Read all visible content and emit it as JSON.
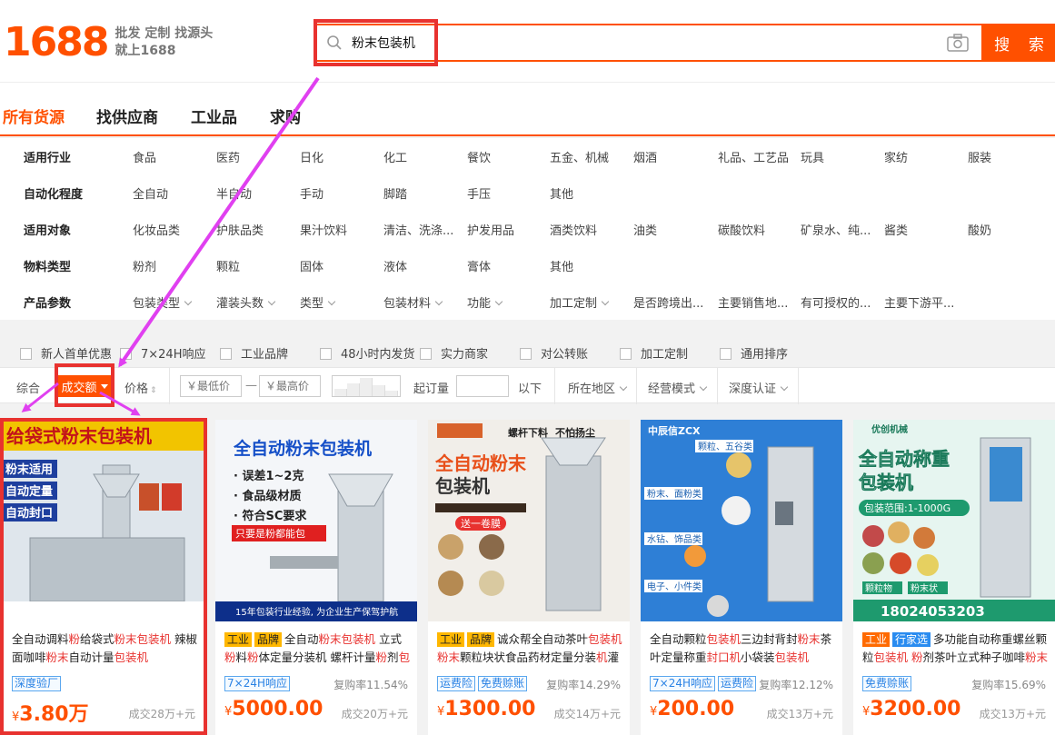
{
  "header": {
    "logo": "1688",
    "slogan_line1": "批发 定制 找源头",
    "slogan_line2": "就上1688",
    "search_value": "粉末包装机",
    "search_button": "搜 索"
  },
  "tabs": [
    "所有货源",
    "找供应商",
    "工业品",
    "求购"
  ],
  "filters": [
    {
      "label": "适用行业",
      "options": [
        "食品",
        "医药",
        "日化",
        "化工",
        "餐饮",
        "五金、机械",
        "烟酒",
        "礼品、工艺品",
        "玩具",
        "家纺",
        "服装"
      ]
    },
    {
      "label": "自动化程度",
      "options": [
        "全自动",
        "半自动",
        "手动",
        "脚踏",
        "手压",
        "其他"
      ]
    },
    {
      "label": "适用对象",
      "options": [
        "化妆品类",
        "护肤品类",
        "果汁饮料",
        "清洁、洗涤...",
        "护发用品",
        "酒类饮料",
        "油类",
        "碳酸饮料",
        "矿泉水、纯...",
        "酱类",
        "酸奶"
      ]
    },
    {
      "label": "物料类型",
      "options": [
        "粉剂",
        "颗粒",
        "固体",
        "液体",
        "膏体",
        "其他"
      ]
    },
    {
      "label": "产品参数",
      "options": [
        "包装类型",
        "灌装头数",
        "类型",
        "包装材料",
        "功能",
        "加工定制",
        "是否跨境出...",
        "主要销售地...",
        "有可授权的...",
        "主要下游平..."
      ]
    }
  ],
  "checkboxes": [
    "新人首单优惠",
    "7×24H响应",
    "工业品牌",
    "48小时内发货",
    "实力商家",
    "对公转账",
    "加工定制",
    "通用排序"
  ],
  "sortbar": {
    "comprehensive": "综合",
    "sales": "成交额",
    "price": "价格",
    "min_price": "￥最低价",
    "dash": "—",
    "max_price": "￥最高价",
    "moq": "起订量",
    "below": "以下",
    "location": "所在地区",
    "mode": "经营模式",
    "cert": "深度认证"
  },
  "products": [
    {
      "title_parts": [
        [
          "全自动调料",
          ""
        ],
        [
          "粉",
          "red"
        ],
        [
          "给袋式",
          ""
        ],
        [
          "粉末包装机",
          "red"
        ],
        [
          " 辣椒面咖啡",
          ""
        ],
        [
          "粉末",
          "red"
        ],
        [
          "自动计量",
          ""
        ],
        [
          "包装机",
          "red"
        ]
      ],
      "tags": [],
      "badges": [
        "深度验厂"
      ],
      "repurchase": "",
      "currency": "¥",
      "price": "3.80万",
      "sold": "成交28万+元",
      "img_text": [
        "给袋式粉末包装机",
        "粉末适用",
        "自动定量",
        "自动封口"
      ]
    },
    {
      "title_parts": [
        [
          "全自动",
          ""
        ],
        [
          "粉末包装机",
          "red"
        ],
        [
          " 立式",
          ""
        ],
        [
          "粉",
          "red"
        ],
        [
          "料",
          ""
        ],
        [
          "粉",
          "red"
        ],
        [
          "体定量分装机 螺杆计量",
          ""
        ],
        [
          "粉",
          "red"
        ],
        [
          "剂",
          ""
        ],
        [
          "包",
          "red"
        ]
      ],
      "tags": [
        [
          "工业",
          "y"
        ],
        [
          "品牌",
          "y"
        ]
      ],
      "badges": [
        "7×24H响应"
      ],
      "repurchase": "复购率11.54%",
      "currency": "¥",
      "price": "5000.00",
      "sold": "成交20万+元",
      "img_text": [
        "全自动粉末包装机",
        "· 误差1~2克",
        "· 食品级材质",
        "· 符合SC要求",
        "只要是粉都能包",
        "15年包装行业经验, 为企业生产保驾护航"
      ]
    },
    {
      "title_parts": [
        [
          "诚众帮全自动茶叶",
          ""
        ],
        [
          "包装机",
          "red"
        ],
        [
          " ",
          ""
        ],
        [
          "粉末",
          "red"
        ],
        [
          "颗粒块状食品药材定量分装",
          ""
        ],
        [
          "机",
          "red"
        ],
        [
          "灌",
          ""
        ]
      ],
      "tags": [
        [
          "工业",
          "y"
        ],
        [
          "品牌",
          "y"
        ]
      ],
      "badges": [
        "运费险",
        "免费赊账"
      ],
      "repurchase": "复购率14.29%",
      "currency": "¥",
      "price": "1300.00",
      "sold": "成交14万+元",
      "img_text": [
        "螺杆下料",
        "不怕扬尘",
        "全自动粉末",
        "包装机",
        "送一卷膜"
      ]
    },
    {
      "title_parts": [
        [
          "全自动颗粒",
          ""
        ],
        [
          "包装机",
          "red"
        ],
        [
          "三边封背封",
          ""
        ],
        [
          "粉末",
          "red"
        ],
        [
          "茶叶定量称重",
          ""
        ],
        [
          "封口机",
          "red"
        ],
        [
          "小袋装",
          ""
        ],
        [
          "包装机",
          "red"
        ]
      ],
      "tags": [],
      "badges": [
        "7×24H响应",
        "运费险"
      ],
      "repurchase": "复购率12.12%",
      "currency": "¥",
      "price": "200.00",
      "sold": "成交13万+元",
      "img_text": [
        "中辰信ZCX",
        "颗粒、五谷类",
        "粉末、面粉类",
        "水钻、饰品类",
        "电子、小件类"
      ]
    },
    {
      "title_parts": [
        [
          "多功能自动称重螺丝颗粒",
          ""
        ],
        [
          "包装机",
          "red"
        ],
        [
          " ",
          ""
        ],
        [
          "粉",
          "red"
        ],
        [
          "剂茶叶立式种子咖啡",
          ""
        ],
        [
          "粉末",
          "red"
        ]
      ],
      "tags": [
        [
          "工业",
          "o"
        ],
        [
          "行家选",
          "b"
        ]
      ],
      "badges": [
        "免费赊账"
      ],
      "repurchase": "复购率15.69%",
      "currency": "¥",
      "price": "3200.00",
      "sold": "成交13万+元",
      "img_text": [
        "优创机械",
        "全自动称重",
        "包装机",
        "包装范围:1-1000G",
        "颗粒物",
        "粉末状",
        "18024053203"
      ]
    }
  ],
  "colors": {
    "brand": "#ff5000",
    "highlight": "#e8322f",
    "arrow": "#e040f0"
  }
}
